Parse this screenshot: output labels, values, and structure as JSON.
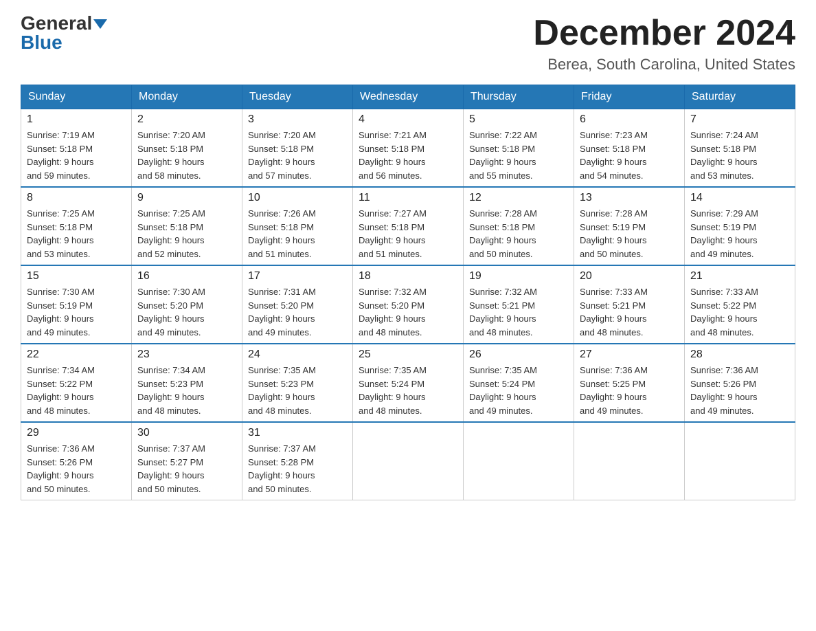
{
  "header": {
    "logo_general": "General",
    "logo_blue": "Blue",
    "month_title": "December 2024",
    "location": "Berea, South Carolina, United States"
  },
  "days_of_week": [
    "Sunday",
    "Monday",
    "Tuesday",
    "Wednesday",
    "Thursday",
    "Friday",
    "Saturday"
  ],
  "weeks": [
    [
      {
        "day": "1",
        "sunrise": "7:19 AM",
        "sunset": "5:18 PM",
        "daylight": "9 hours and 59 minutes."
      },
      {
        "day": "2",
        "sunrise": "7:20 AM",
        "sunset": "5:18 PM",
        "daylight": "9 hours and 58 minutes."
      },
      {
        "day": "3",
        "sunrise": "7:20 AM",
        "sunset": "5:18 PM",
        "daylight": "9 hours and 57 minutes."
      },
      {
        "day": "4",
        "sunrise": "7:21 AM",
        "sunset": "5:18 PM",
        "daylight": "9 hours and 56 minutes."
      },
      {
        "day": "5",
        "sunrise": "7:22 AM",
        "sunset": "5:18 PM",
        "daylight": "9 hours and 55 minutes."
      },
      {
        "day": "6",
        "sunrise": "7:23 AM",
        "sunset": "5:18 PM",
        "daylight": "9 hours and 54 minutes."
      },
      {
        "day": "7",
        "sunrise": "7:24 AM",
        "sunset": "5:18 PM",
        "daylight": "9 hours and 53 minutes."
      }
    ],
    [
      {
        "day": "8",
        "sunrise": "7:25 AM",
        "sunset": "5:18 PM",
        "daylight": "9 hours and 53 minutes."
      },
      {
        "day": "9",
        "sunrise": "7:25 AM",
        "sunset": "5:18 PM",
        "daylight": "9 hours and 52 minutes."
      },
      {
        "day": "10",
        "sunrise": "7:26 AM",
        "sunset": "5:18 PM",
        "daylight": "9 hours and 51 minutes."
      },
      {
        "day": "11",
        "sunrise": "7:27 AM",
        "sunset": "5:18 PM",
        "daylight": "9 hours and 51 minutes."
      },
      {
        "day": "12",
        "sunrise": "7:28 AM",
        "sunset": "5:18 PM",
        "daylight": "9 hours and 50 minutes."
      },
      {
        "day": "13",
        "sunrise": "7:28 AM",
        "sunset": "5:19 PM",
        "daylight": "9 hours and 50 minutes."
      },
      {
        "day": "14",
        "sunrise": "7:29 AM",
        "sunset": "5:19 PM",
        "daylight": "9 hours and 49 minutes."
      }
    ],
    [
      {
        "day": "15",
        "sunrise": "7:30 AM",
        "sunset": "5:19 PM",
        "daylight": "9 hours and 49 minutes."
      },
      {
        "day": "16",
        "sunrise": "7:30 AM",
        "sunset": "5:20 PM",
        "daylight": "9 hours and 49 minutes."
      },
      {
        "day": "17",
        "sunrise": "7:31 AM",
        "sunset": "5:20 PM",
        "daylight": "9 hours and 49 minutes."
      },
      {
        "day": "18",
        "sunrise": "7:32 AM",
        "sunset": "5:20 PM",
        "daylight": "9 hours and 48 minutes."
      },
      {
        "day": "19",
        "sunrise": "7:32 AM",
        "sunset": "5:21 PM",
        "daylight": "9 hours and 48 minutes."
      },
      {
        "day": "20",
        "sunrise": "7:33 AM",
        "sunset": "5:21 PM",
        "daylight": "9 hours and 48 minutes."
      },
      {
        "day": "21",
        "sunrise": "7:33 AM",
        "sunset": "5:22 PM",
        "daylight": "9 hours and 48 minutes."
      }
    ],
    [
      {
        "day": "22",
        "sunrise": "7:34 AM",
        "sunset": "5:22 PM",
        "daylight": "9 hours and 48 minutes."
      },
      {
        "day": "23",
        "sunrise": "7:34 AM",
        "sunset": "5:23 PM",
        "daylight": "9 hours and 48 minutes."
      },
      {
        "day": "24",
        "sunrise": "7:35 AM",
        "sunset": "5:23 PM",
        "daylight": "9 hours and 48 minutes."
      },
      {
        "day": "25",
        "sunrise": "7:35 AM",
        "sunset": "5:24 PM",
        "daylight": "9 hours and 48 minutes."
      },
      {
        "day": "26",
        "sunrise": "7:35 AM",
        "sunset": "5:24 PM",
        "daylight": "9 hours and 49 minutes."
      },
      {
        "day": "27",
        "sunrise": "7:36 AM",
        "sunset": "5:25 PM",
        "daylight": "9 hours and 49 minutes."
      },
      {
        "day": "28",
        "sunrise": "7:36 AM",
        "sunset": "5:26 PM",
        "daylight": "9 hours and 49 minutes."
      }
    ],
    [
      {
        "day": "29",
        "sunrise": "7:36 AM",
        "sunset": "5:26 PM",
        "daylight": "9 hours and 50 minutes."
      },
      {
        "day": "30",
        "sunrise": "7:37 AM",
        "sunset": "5:27 PM",
        "daylight": "9 hours and 50 minutes."
      },
      {
        "day": "31",
        "sunrise": "7:37 AM",
        "sunset": "5:28 PM",
        "daylight": "9 hours and 50 minutes."
      },
      null,
      null,
      null,
      null
    ]
  ],
  "labels": {
    "sunrise": "Sunrise:",
    "sunset": "Sunset:",
    "daylight": "Daylight:"
  }
}
